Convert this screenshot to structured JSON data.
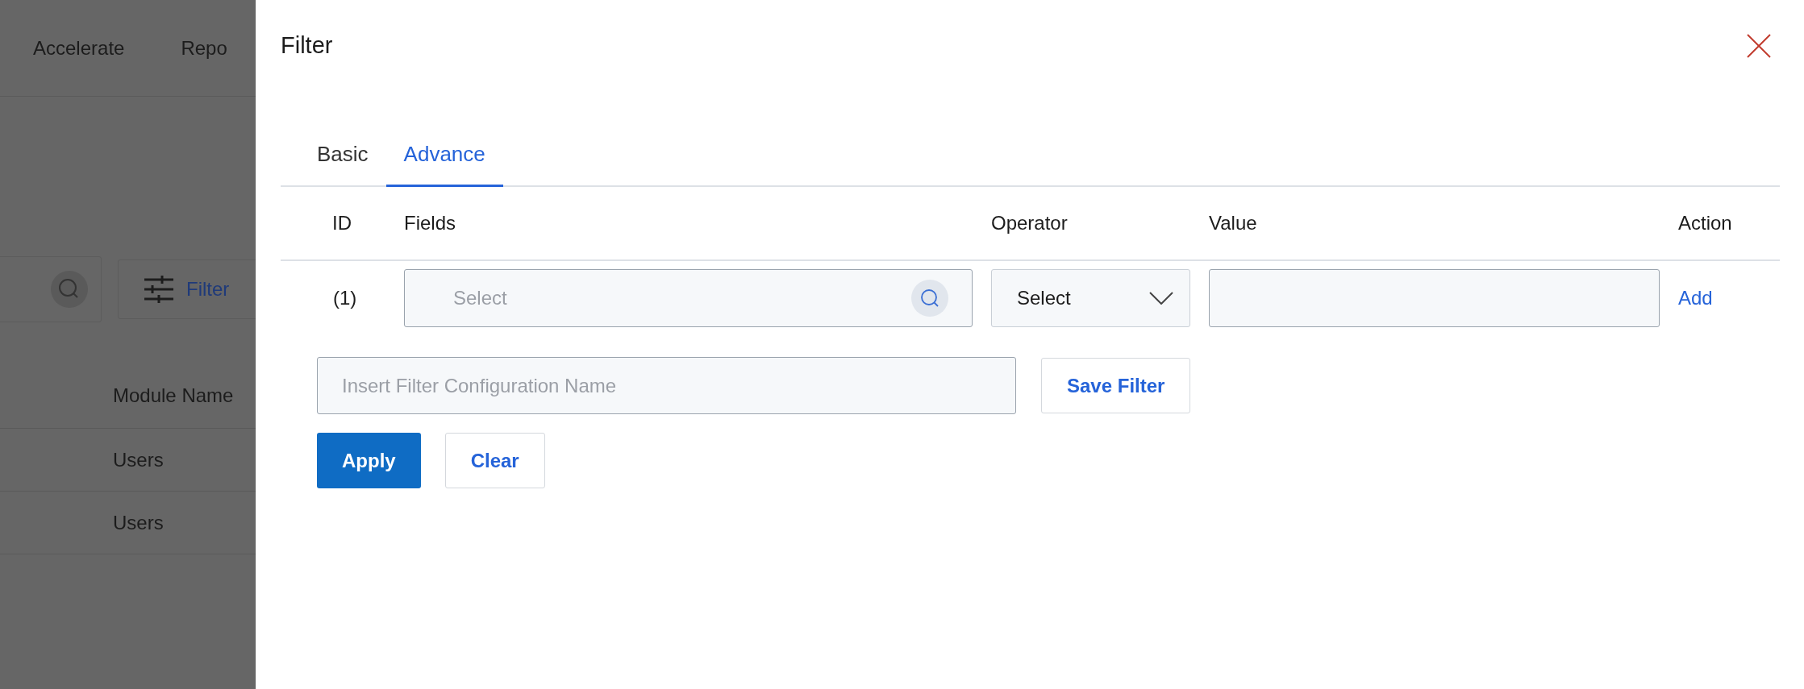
{
  "background": {
    "nav": [
      "Accelerate",
      "Repo"
    ],
    "filter_button": "Filter",
    "table": {
      "columns": [
        "Module Name"
      ],
      "rows": [
        [
          "Users"
        ],
        [
          "Users"
        ]
      ]
    }
  },
  "drawer": {
    "title": "Filter",
    "tabs": [
      {
        "label": "Basic",
        "selected": false
      },
      {
        "label": "Advance",
        "selected": true
      }
    ],
    "columns": [
      "ID",
      "Fields",
      "Operator",
      "Value",
      "Action"
    ],
    "rows": [
      {
        "id": "(1)",
        "field_placeholder": "Select",
        "operator": "Select",
        "action": "Add"
      }
    ],
    "config_name": {
      "placeholder": "Insert Filter Configuration Name"
    },
    "save_button": "Save Filter",
    "apply_button": "Apply",
    "clear_button": "Clear"
  }
}
